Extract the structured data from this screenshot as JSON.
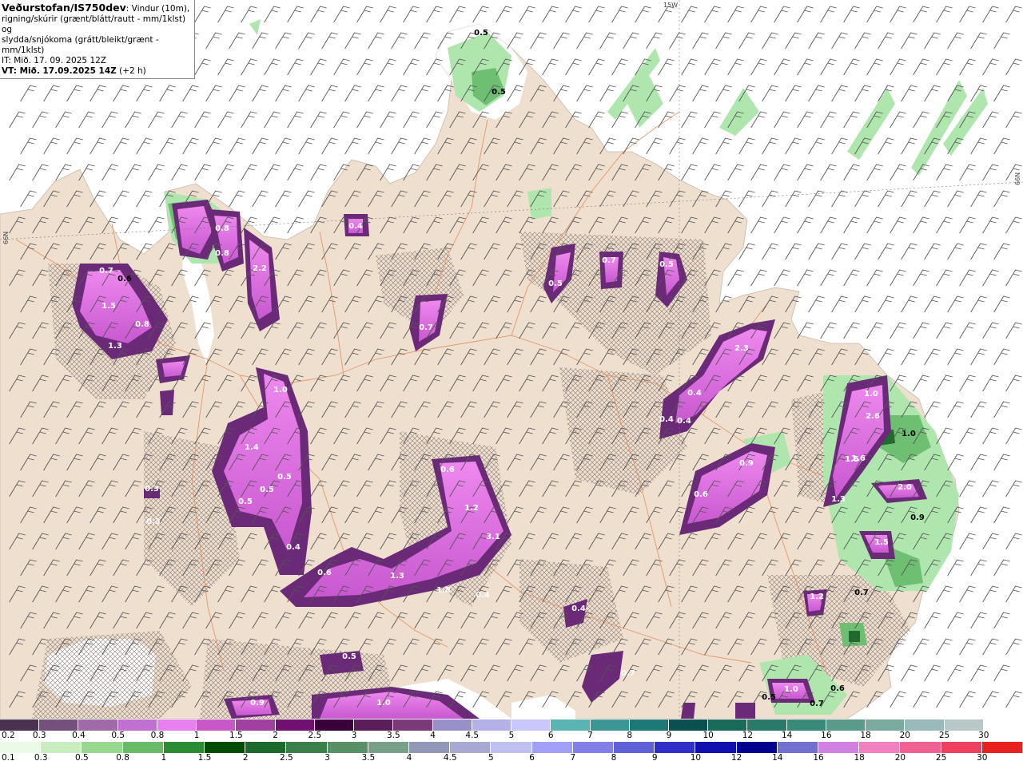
{
  "info": {
    "title": "Veðurstofan/IS750dev",
    "title_suffix": ": Vindur (10m),",
    "line2": "rigning/skúrir (grænt/blátt/rautt - mm/1klst) og",
    "line3": "slydda/snjókoma (grátt/bleikt/grænt - mm/1klst)",
    "line4": "IT: Mið. 17. 09. 2025 12Z",
    "line5_bold": "VT: Mið. 17.09.2025 14Z",
    "line5_rest": " (+2 h)"
  },
  "grid_labels": {
    "lon": "15W",
    "lat_left": "66N",
    "lat_right": "66N"
  },
  "colors": {
    "land": "#eedfcf",
    "sea": "#ffffff",
    "roads": "#e58a5c",
    "snow_mid": "#cc55dd",
    "snow_dark": "#6b2a78",
    "snow_light": "#ee88ee",
    "rain_light": "#aee6ad",
    "rain_mid": "#6fbf73",
    "rain_dark": "#1e6b2e",
    "wind_barb": "#555555"
  },
  "legend_snow": {
    "labels": [
      "0.2",
      "0.3",
      "0.4",
      "0.5",
      "0.8",
      "1",
      "1.5",
      "2",
      "2.5",
      "3",
      "3.5",
      "4",
      "4.5",
      "5",
      "6",
      "7",
      "8",
      "9",
      "10",
      "12",
      "14",
      "16",
      "18",
      "20",
      "25",
      "30"
    ],
    "colors": [
      "#4a3150",
      "#74507c",
      "#a06aa8",
      "#c070d0",
      "#e880f0",
      "#c858c8",
      "#a040a0",
      "#701070",
      "#3a003a",
      "#5a1e5a",
      "#7a3a7a",
      "#9890c8",
      "#b4b0e8",
      "#c8c8ff",
      "#5ab4b4",
      "#3c9696",
      "#1e7878",
      "#0a5050",
      "#1a6a5a",
      "#2a7a6a",
      "#3a8a7a",
      "#5a9a8a",
      "#7aaaa0",
      "#9ababa",
      "#b8c8c8",
      "#ffffff"
    ]
  },
  "legend_rain": {
    "labels": [
      "0.1",
      "0.3",
      "0.5",
      "0.8",
      "1",
      "1.5",
      "2",
      "2.5",
      "3",
      "3.5",
      "4",
      "4.5",
      "5",
      "6",
      "7",
      "8",
      "9",
      "10",
      "12",
      "14",
      "16",
      "18",
      "20",
      "25",
      "30"
    ],
    "colors": [
      "#e8fae4",
      "#c8eec0",
      "#98d890",
      "#68bc68",
      "#2c8c34",
      "#004c00",
      "#1c6a2c",
      "#3a8048",
      "#5a9068",
      "#78a088",
      "#9098b8",
      "#a8a8d4",
      "#c0c0f0",
      "#a0a0f8",
      "#8080e8",
      "#6060d8",
      "#3030c8",
      "#1010b0",
      "#000090",
      "#7070d0",
      "#d080e0",
      "#f080c0",
      "#f06090",
      "#f04060",
      "#e82020"
    ]
  },
  "map_values": [
    {
      "label": "0.5",
      "dark": true
    },
    {
      "label": "0.5",
      "dark": true
    },
    {
      "label": "0.4"
    },
    {
      "label": "0.8"
    },
    {
      "label": "0.8"
    },
    {
      "label": "2.2"
    },
    {
      "label": "0.7"
    },
    {
      "label": "1.5"
    },
    {
      "label": "0.8"
    },
    {
      "label": "1.3"
    },
    {
      "label": "0.6",
      "dark": true
    },
    {
      "label": "1.0"
    },
    {
      "label": "0.7"
    },
    {
      "label": "0.5"
    },
    {
      "label": "0.7"
    },
    {
      "label": "0.5"
    },
    {
      "label": "2.3"
    },
    {
      "label": "0.4"
    },
    {
      "label": "0.4"
    },
    {
      "label": "0.4"
    },
    {
      "label": "1.0"
    },
    {
      "label": "1.5"
    },
    {
      "label": "1.4"
    },
    {
      "label": "0.5"
    },
    {
      "label": "0.5"
    },
    {
      "label": "0.5"
    },
    {
      "label": "0.4"
    },
    {
      "label": "0.3"
    },
    {
      "label": "0.6"
    },
    {
      "label": "1.2"
    },
    {
      "label": "3.1"
    },
    {
      "label": "0.6"
    },
    {
      "label": "1.3"
    },
    {
      "label": "1.8"
    },
    {
      "label": "0.4"
    },
    {
      "label": "0.9"
    },
    {
      "label": "0.6"
    },
    {
      "label": "2.6"
    },
    {
      "label": "1.0",
      "dark": true
    },
    {
      "label": "1.6"
    },
    {
      "label": "2.0"
    },
    {
      "label": "1.3"
    },
    {
      "label": "0.9",
      "dark": true
    },
    {
      "label": "1.5"
    },
    {
      "label": "0.7",
      "dark": true
    },
    {
      "label": "1.2"
    },
    {
      "label": "0.5"
    },
    {
      "label": "1.0"
    },
    {
      "label": "0.6",
      "dark": true
    },
    {
      "label": "0.7",
      "dark": true
    },
    {
      "label": "0.5",
      "dark": true
    },
    {
      "label": "0.9"
    },
    {
      "label": "1.0"
    },
    {
      "label": "0.7"
    },
    {
      "label": "0.4"
    },
    {
      "label": "0.3"
    }
  ]
}
